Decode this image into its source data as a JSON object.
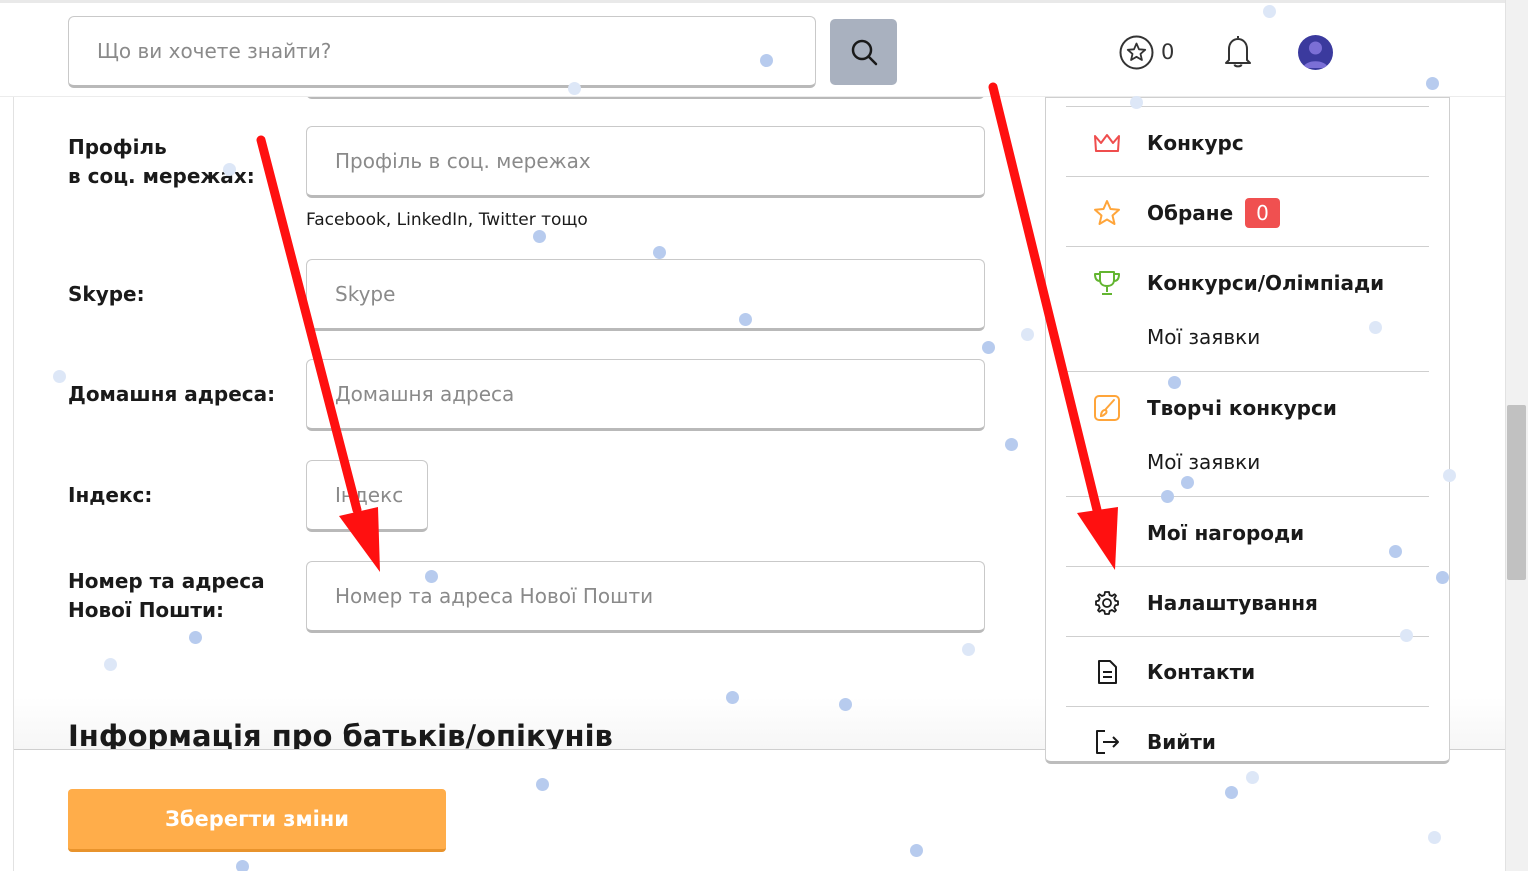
{
  "header": {
    "search_placeholder": "Що ви хочете знайти?",
    "favorites_count": "0"
  },
  "form": {
    "social_label": "Профіль\nв соц. мережах:",
    "social_placeholder": "Профіль в соц. мережах",
    "social_hint": "Facebook, LinkedIn, Twitter тощо",
    "skype_label": "Skype:",
    "skype_placeholder": "Skype",
    "address_label": "Домашня адреса:",
    "address_placeholder": "Домашня адреса",
    "index_label": "Індекс:",
    "index_placeholder": "Індекс",
    "nova_label": "Номер та адреса\nНової Пошти:",
    "nova_placeholder": "Номер та адреса Нової Пошти",
    "section_title": "Інформація про батьків/опікунів"
  },
  "footer": {
    "save_label": "Зберегти зміни"
  },
  "menu": {
    "contest": "Конкурс",
    "favorites": "Обране",
    "favorites_badge": "0",
    "olympiads": "Конкурси/Олімпіади",
    "olympiads_sub": "Мої заявки",
    "creative": "Творчі конкурси",
    "creative_sub": "Мої заявки",
    "awards": "Мої нагороди",
    "settings": "Налаштування",
    "contacts": "Контакти",
    "logout": "Вийти"
  },
  "colors": {
    "accent_orange": "#ffad4a",
    "badge_red": "#f05050",
    "search_button": "#a9b1bf",
    "arrow_red": "#ff1010",
    "crown_red": "#ef4d4d",
    "star_orange": "#ffa53a",
    "trophy_green": "#63b531"
  },
  "icons": {
    "search": "search-icon",
    "favorites": "star-circle-icon",
    "notifications": "bell-icon",
    "contest": "crown-icon",
    "favorites_menu": "star-icon",
    "olympiads": "trophy-icon",
    "creative": "paint-brush-icon",
    "settings": "gear-icon",
    "contacts": "document-icon",
    "logout": "logout-icon"
  }
}
